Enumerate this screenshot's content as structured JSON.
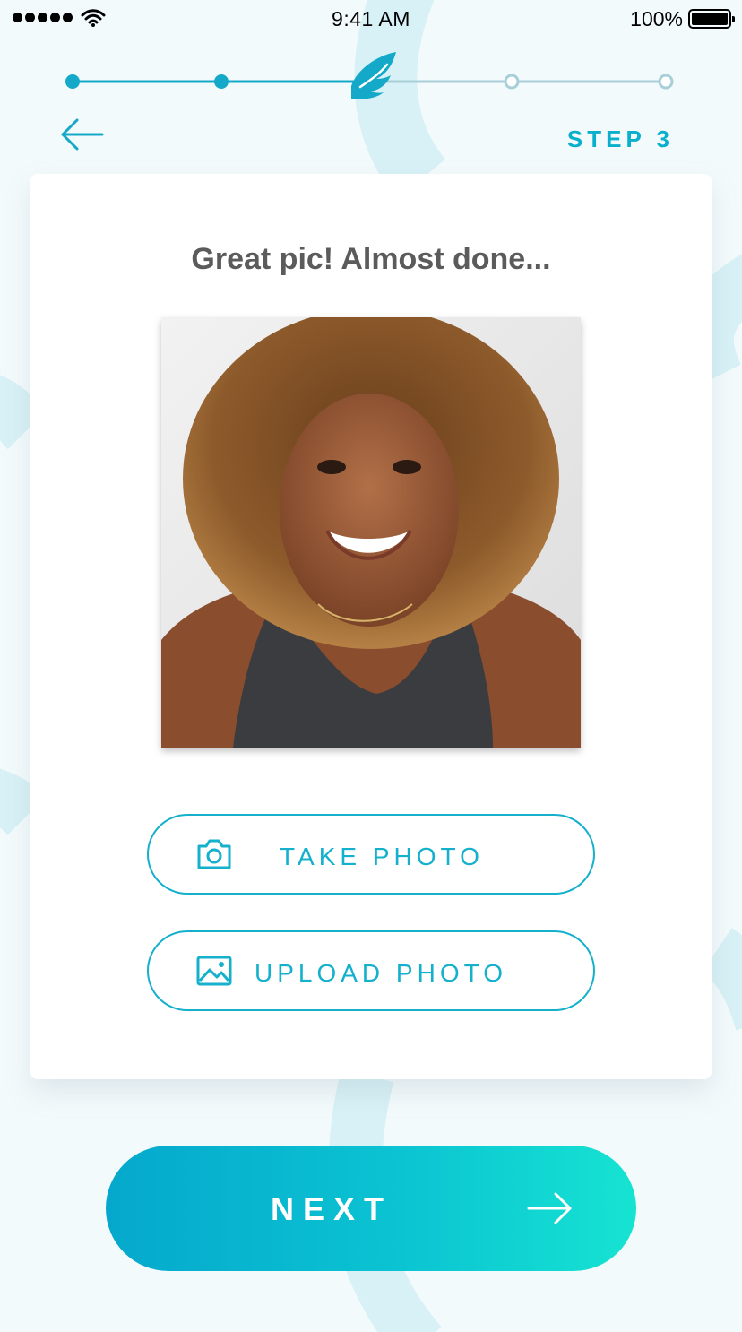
{
  "status_bar": {
    "time": "9:41 AM",
    "battery": "100%",
    "signal_icon": "signal-dots-icon",
    "wifi_icon": "wifi-icon",
    "battery_icon": "battery-icon"
  },
  "progress": {
    "current_step": 3,
    "total_steps": 5,
    "current_icon": "wing-icon"
  },
  "header": {
    "back_icon": "arrow-left-icon",
    "step_label": "STEP 3"
  },
  "card": {
    "title": "Great pic! Almost done...",
    "take_photo_label": "TAKE PHOTO",
    "take_photo_icon": "camera-icon",
    "upload_photo_label": "UPLOAD PHOTO",
    "upload_photo_icon": "image-icon"
  },
  "footer": {
    "next_label": "NEXT",
    "next_icon": "arrow-right-icon"
  },
  "colors": {
    "accent": "#0aafcc",
    "gradient_start": "#05a8cc",
    "gradient_end": "#16e3d2",
    "background": "#f3fafc",
    "progress_inactive": "#a8cfd8"
  }
}
